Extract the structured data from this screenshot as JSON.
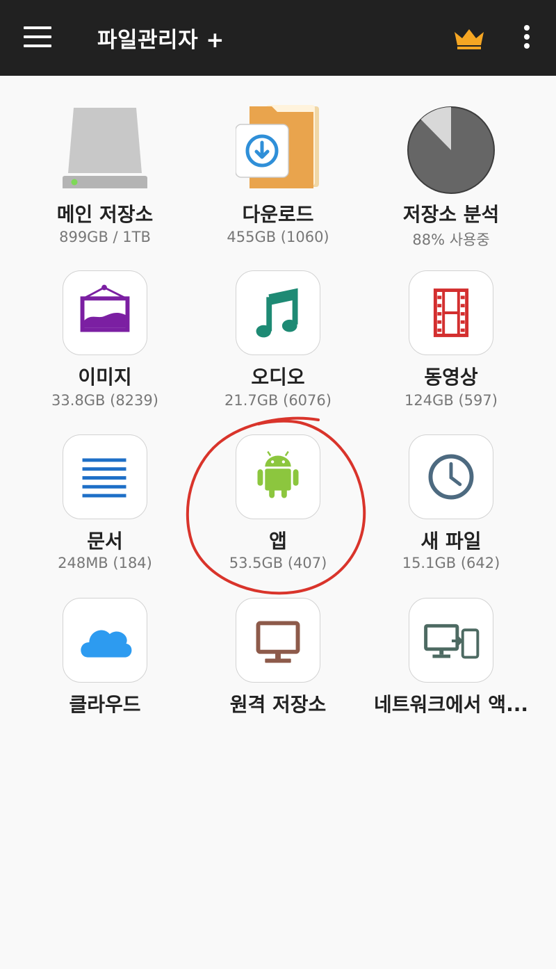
{
  "app": {
    "title": "파일관리자 +"
  },
  "colors": {
    "appbar": "#212121",
    "crown": "#f5a623",
    "annotation": "#d9342b"
  },
  "items": [
    {
      "label": "메인 저장소",
      "sub": "899GB / 1TB",
      "icon": "hard-drive-icon"
    },
    {
      "label": "다운로드",
      "sub": "455GB (1060)",
      "icon": "download-folder-icon"
    },
    {
      "label": "저장소 분석",
      "sub": "88% 사용중",
      "icon": "pie-chart-icon",
      "used_fraction": 0.88
    },
    {
      "label": "이미지",
      "sub": "33.8GB (8239)",
      "icon": "image-frame-icon"
    },
    {
      "label": "오디오",
      "sub": "21.7GB (6076)",
      "icon": "music-note-icon"
    },
    {
      "label": "동영상",
      "sub": "124GB (597)",
      "icon": "film-strip-icon"
    },
    {
      "label": "문서",
      "sub": "248MB (184)",
      "icon": "document-lines-icon"
    },
    {
      "label": "앱",
      "sub": "53.5GB (407)",
      "icon": "android-icon"
    },
    {
      "label": "새 파일",
      "sub": "15.1GB (642)",
      "icon": "clock-icon"
    },
    {
      "label": "클라우드",
      "sub": "",
      "icon": "cloud-icon"
    },
    {
      "label": "원격 저장소",
      "sub": "",
      "icon": "monitor-icon"
    },
    {
      "label": "네트워크에서 액...",
      "sub": "",
      "icon": "network-devices-icon"
    }
  ]
}
